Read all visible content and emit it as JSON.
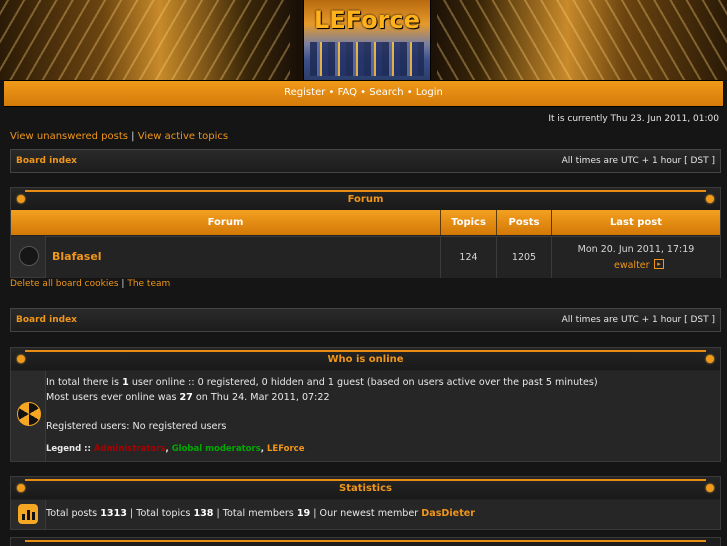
{
  "header": {
    "logo_text": "LEForce"
  },
  "nav": {
    "register": "Register",
    "sep1": " • ",
    "faq": "FAQ",
    "sep2": " • ",
    "search": "Search",
    "sep3": " • ",
    "login": "Login"
  },
  "current_time": "It is currently Thu 23. Jun 2011, 01:00",
  "quick_links": {
    "unanswered": "View unanswered posts",
    "sep": " | ",
    "active": "View active topics"
  },
  "crumb_bar": {
    "board_index": "Board index",
    "times": "All times are UTC + 1 hour [ DST ]"
  },
  "forum_panel": {
    "title": "Forum",
    "headers": {
      "forum": "Forum",
      "topics": "Topics",
      "posts": "Posts",
      "last_post": "Last post"
    },
    "rows": [
      {
        "name": "Blafasel",
        "topics": "124",
        "posts": "1205",
        "last_post_date": "Mon 20. Jun 2011, 17:19",
        "last_post_user": "ewalter"
      }
    ]
  },
  "footer_links": {
    "delete_cookies": "Delete all board cookies",
    "sep": " | ",
    "team": "The team"
  },
  "online_panel": {
    "title": "Who is online",
    "line1_a": "In total there is ",
    "line1_count": "1",
    "line1_b": " user online :: 0 registered, 0 hidden and 1 guest (based on users active over the past 5 minutes)",
    "line2_a": "Most users ever online was ",
    "line2_count": "27",
    "line2_b": " on Thu 24. Mar 2011, 07:22",
    "registered": "Registered users: No registered users",
    "legend_label": "Legend :: ",
    "legend_admin": "Administrators",
    "legend_sep1": ", ",
    "legend_gmod": "Global moderators",
    "legend_sep2": ", ",
    "legend_group": "LEForce",
    "colors": {
      "admin": "#aa0000",
      "gmod": "#00aa00",
      "group": "#f0961a"
    }
  },
  "stats_panel": {
    "title": "Statistics",
    "a": "Total posts ",
    "posts": "1313",
    "b": " | Total topics ",
    "topics": "138",
    "c": " | Total members ",
    "members": "19",
    "d": " | Our newest member ",
    "newest": "DasDieter"
  },
  "icons": {
    "forum_icon": "radio-button-icon",
    "online_icon": "radiation-icon",
    "stats_icon": "bar-chart-icon",
    "newpost_icon": "arrow-right-icon"
  }
}
